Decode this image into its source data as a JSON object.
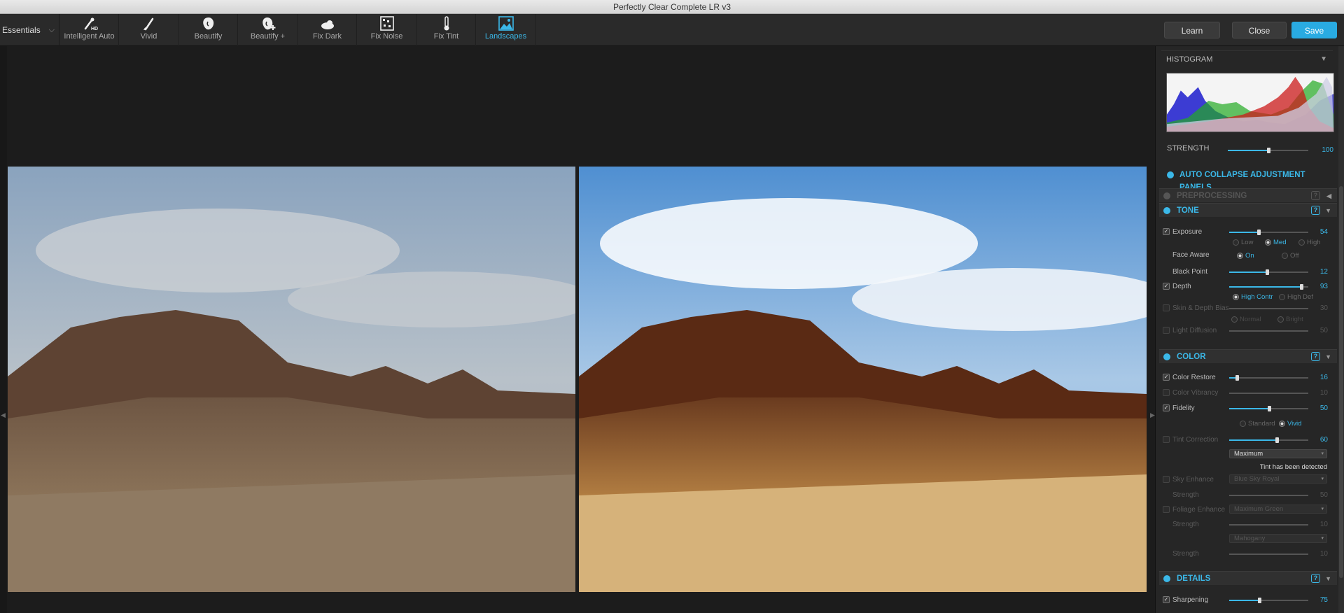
{
  "window": {
    "title": "Perfectly Clear Complete LR v3"
  },
  "toolbar": {
    "preset": "Essentials",
    "tools": [
      {
        "label": "Intelligent Auto",
        "icon": "wand-hd-icon"
      },
      {
        "label": "Vivid",
        "icon": "brush-icon"
      },
      {
        "label": "Beautify",
        "icon": "face-icon"
      },
      {
        "label": "Beautify +",
        "icon": "face-plus-icon"
      },
      {
        "label": "Fix Dark",
        "icon": "cloud-sun-icon"
      },
      {
        "label": "Fix Noise",
        "icon": "noise-grid-icon"
      },
      {
        "label": "Fix Tint",
        "icon": "thermometer-icon"
      },
      {
        "label": "Landscapes",
        "icon": "landscape-icon",
        "active": true
      }
    ],
    "learn": "Learn",
    "close": "Close",
    "save": "Save"
  },
  "colors": {
    "accent": "#3bb8e8",
    "panel": "#262626",
    "background": "#1c1c1c"
  },
  "panel": {
    "histogram": "HISTOGRAM",
    "strength": {
      "label": "STRENGTH",
      "value": "100",
      "level": 0.5
    },
    "auto_collapse": "AUTO COLLAPSE ADJUSTMENT PANELS",
    "preprocessing": "PREPROCESSING",
    "tone": {
      "title": "TONE",
      "exposure": {
        "label": "Exposure",
        "value": "54",
        "level": 0.37
      },
      "exposure_modes": [
        "Low",
        "Med",
        "High"
      ],
      "face_aware": {
        "label": "Face Aware",
        "on": "On",
        "off": "Off"
      },
      "black_point": {
        "label": "Black Point",
        "value": "12",
        "level": 0.48
      },
      "depth": {
        "label": "Depth",
        "value": "93",
        "level": 0.91
      },
      "depth_modes": [
        "High Contr",
        "High Def"
      ],
      "skin_depth": {
        "label": "Skin & Depth Bias",
        "value": "30",
        "level": 0.3
      },
      "skin_modes": [
        "Normal",
        "Bright"
      ],
      "light_diffusion": {
        "label": "Light Diffusion",
        "value": "50",
        "level": 0.5
      }
    },
    "color": {
      "title": "COLOR",
      "color_restore": {
        "label": "Color Restore",
        "value": "16",
        "level": 0.1
      },
      "color_vibrancy": {
        "label": "Color Vibrancy",
        "value": "10",
        "level": 0.1
      },
      "fidelity": {
        "label": "Fidelity",
        "value": "50",
        "level": 0.5
      },
      "fidelity_modes": [
        "Standard",
        "Vivid"
      ],
      "tint_correction": {
        "label": "Tint Correction",
        "value": "60",
        "level": 0.6
      },
      "tint_mode": "Maximum",
      "tint_note": "Tint has been detected",
      "sky_enhance": {
        "label": "Sky Enhance",
        "select": "Blue Sky Royal"
      },
      "sky_strength": {
        "label": "Strength",
        "value": "50",
        "level": 0.5
      },
      "foliage_enhance": {
        "label": "Foliage Enhance",
        "select": "Maximum Green"
      },
      "foliage_strength": {
        "label": "Strength",
        "value": "10",
        "level": 0.1
      },
      "third_select": "Mahogany",
      "third_strength": {
        "label": "Strength",
        "value": "10",
        "level": 0.1
      }
    },
    "details": {
      "title": "DETAILS",
      "sharpening": {
        "label": "Sharpening",
        "value": "75",
        "level": 0.38
      }
    }
  }
}
